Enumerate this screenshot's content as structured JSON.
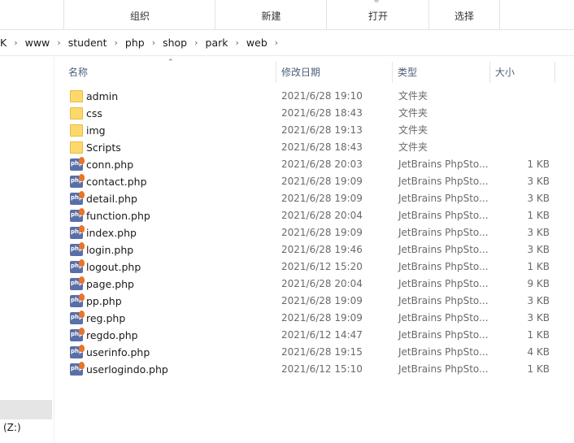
{
  "ribbon": {
    "groups": [
      {
        "label": "组织"
      },
      {
        "label": "新建"
      },
      {
        "label": "打开"
      },
      {
        "label": "选择"
      }
    ]
  },
  "breadcrumb": [
    "K",
    "www",
    "student",
    "php",
    "shop",
    "park",
    "web"
  ],
  "columns": {
    "name": "名称",
    "date": "修改日期",
    "type": "类型",
    "size": "大小"
  },
  "files": [
    {
      "name": "admin",
      "date": "2021/6/28 19:10",
      "type": "文件夹",
      "size": "",
      "kind": "folder-icon"
    },
    {
      "name": "css",
      "date": "2021/6/28 18:43",
      "type": "文件夹",
      "size": "",
      "kind": "folder-icon"
    },
    {
      "name": "img",
      "date": "2021/6/28 19:13",
      "type": "文件夹",
      "size": "",
      "kind": "folder-icon"
    },
    {
      "name": "Scripts",
      "date": "2021/6/28 18:43",
      "type": "文件夹",
      "size": "",
      "kind": "folder-icon"
    },
    {
      "name": "conn.php",
      "date": "2021/6/28 20:03",
      "type": "JetBrains PhpSto...",
      "size": "1 KB",
      "kind": "php-file-icon"
    },
    {
      "name": "contact.php",
      "date": "2021/6/28 19:09",
      "type": "JetBrains PhpSto...",
      "size": "3 KB",
      "kind": "php-file-icon"
    },
    {
      "name": "detail.php",
      "date": "2021/6/28 19:09",
      "type": "JetBrains PhpSto...",
      "size": "3 KB",
      "kind": "php-file-icon"
    },
    {
      "name": "function.php",
      "date": "2021/6/28 20:04",
      "type": "JetBrains PhpSto...",
      "size": "1 KB",
      "kind": "php-file-icon"
    },
    {
      "name": "index.php",
      "date": "2021/6/28 19:09",
      "type": "JetBrains PhpSto...",
      "size": "3 KB",
      "kind": "php-file-icon"
    },
    {
      "name": "login.php",
      "date": "2021/6/28 19:46",
      "type": "JetBrains PhpSto...",
      "size": "3 KB",
      "kind": "php-file-icon"
    },
    {
      "name": "logout.php",
      "date": "2021/6/12 15:20",
      "type": "JetBrains PhpSto...",
      "size": "1 KB",
      "kind": "php-file-icon"
    },
    {
      "name": "page.php",
      "date": "2021/6/28 20:04",
      "type": "JetBrains PhpSto...",
      "size": "9 KB",
      "kind": "php-file-icon"
    },
    {
      "name": "pp.php",
      "date": "2021/6/28 19:09",
      "type": "JetBrains PhpSto...",
      "size": "3 KB",
      "kind": "php-file-icon"
    },
    {
      "name": "reg.php",
      "date": "2021/6/28 19:09",
      "type": "JetBrains PhpSto...",
      "size": "3 KB",
      "kind": "php-file-icon"
    },
    {
      "name": "regdo.php",
      "date": "2021/6/12 14:47",
      "type": "JetBrains PhpSto...",
      "size": "1 KB",
      "kind": "php-file-icon"
    },
    {
      "name": "userinfo.php",
      "date": "2021/6/28 19:15",
      "type": "JetBrains PhpSto...",
      "size": "4 KB",
      "kind": "php-file-icon"
    },
    {
      "name": "userlogindo.php",
      "date": "2021/6/12 15:10",
      "type": "JetBrains PhpSto...",
      "size": "1 KB",
      "kind": "php-file-icon"
    }
  ],
  "nav": {
    "drive_label": "(Z:)"
  },
  "icons": {
    "php_badge_text": "php"
  },
  "colors": {
    "folder": "#ffd86b",
    "php_icon": "#5a6fa6",
    "header_text": "#4c607a",
    "selection": "#e5e5e5"
  }
}
